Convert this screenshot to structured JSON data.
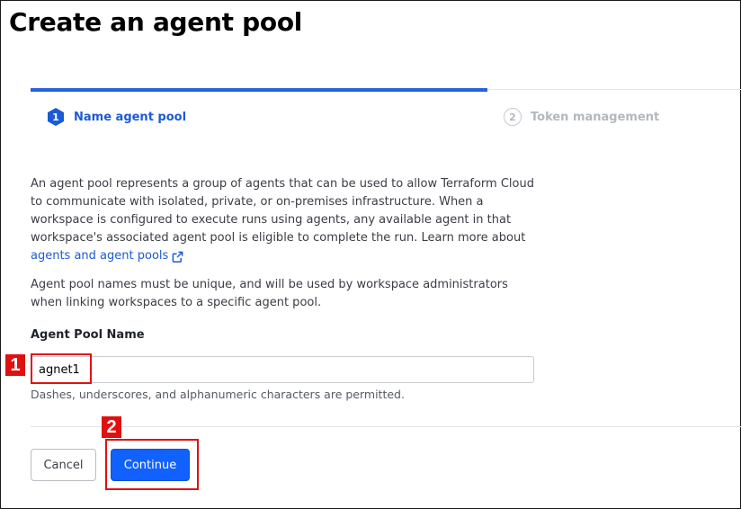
{
  "page": {
    "title": "Create an agent pool"
  },
  "steps": [
    {
      "number": "1",
      "label": "Name agent pool",
      "state": "active"
    },
    {
      "number": "2",
      "label": "Token management",
      "state": "inactive"
    }
  ],
  "description": {
    "paragraph1": "An agent pool represents a group of agents that can be used to allow Terraform Cloud to communicate with isolated, private, or on-premises infrastructure. When a workspace is configured to execute runs using agents, any available agent in that workspace's associated agent pool is eligible to complete the run. Learn more about",
    "link_label": "agents and agent pools",
    "paragraph2": "Agent pool names must be unique, and will be used by workspace administrators when linking workspaces to a specific agent pool."
  },
  "form": {
    "field_label": "Agent Pool Name",
    "field_value": "agnet1",
    "hint": "Dashes, underscores, and alphanumeric characters are permitted."
  },
  "actions": {
    "cancel_label": "Cancel",
    "continue_label": "Continue"
  },
  "annotations": {
    "marker1": "1",
    "marker2": "2"
  },
  "colors": {
    "accent": "#1c5ad6",
    "primary_button": "#1061ff",
    "annotation": "#e01010"
  },
  "icons": {
    "external_link": "external-link-icon"
  }
}
